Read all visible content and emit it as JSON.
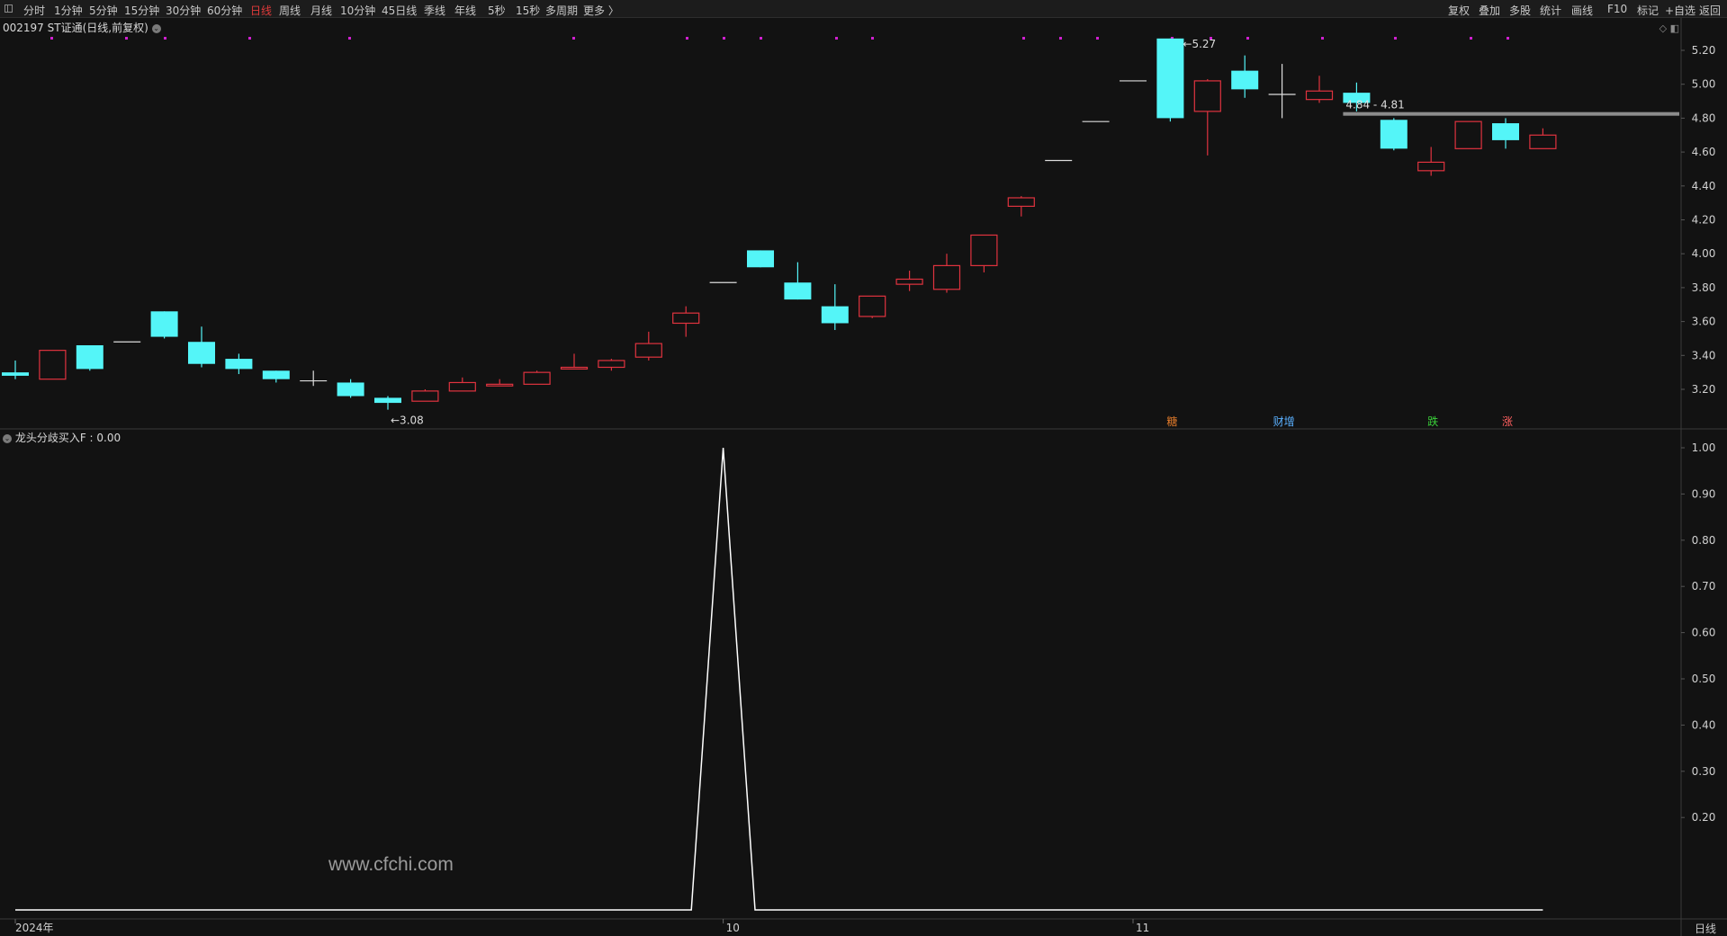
{
  "toolbar": {
    "periods": [
      {
        "label": "分时"
      },
      {
        "label": "1分钟"
      },
      {
        "label": "5分钟"
      },
      {
        "label": "15分钟"
      },
      {
        "label": "30分钟"
      },
      {
        "label": "60分钟"
      },
      {
        "label": "日线",
        "active": true
      },
      {
        "label": "周线"
      },
      {
        "label": "月线"
      },
      {
        "label": "10分钟"
      },
      {
        "label": "45日线"
      },
      {
        "label": "季线"
      },
      {
        "label": "年线"
      },
      {
        "label": "5秒"
      },
      {
        "label": "15秒"
      },
      {
        "label": "多周期"
      },
      {
        "label": "更多 〉"
      }
    ],
    "tools": [
      {
        "label": "复权"
      },
      {
        "label": "叠加"
      },
      {
        "label": "多股"
      },
      {
        "label": "统计"
      },
      {
        "label": "画线"
      },
      {
        "label": "F10"
      },
      {
        "label": "标记"
      },
      {
        "label": "+自选"
      },
      {
        "label": "返回"
      }
    ]
  },
  "main": {
    "title": "002197 ST证通(日线,前复权)",
    "price_ticks": [
      "5.20",
      "5.00",
      "4.80",
      "4.60",
      "4.40",
      "4.20",
      "4.00",
      "3.80",
      "3.60",
      "3.40",
      "3.20"
    ],
    "high_label": "5.27",
    "low_label": "3.08",
    "range_label": "4.84 - 4.81",
    "event_tags": [
      {
        "text": "糖",
        "color": "#e07a2a"
      },
      {
        "text": "财增",
        "color": "#5ab0ff"
      },
      {
        "text": "跌",
        "color": "#3ad03a"
      },
      {
        "text": "涨",
        "color": "#ff6060"
      }
    ],
    "colors": {
      "up": "#e0333f",
      "down": "#54f5f8",
      "flat": "#dcdcdc",
      "marker": "#d020d0",
      "resistance": "#8c8c8c"
    }
  },
  "indicator": {
    "title": "龙头分歧买入F : 0.00",
    "ticks": [
      "1.00",
      "0.90",
      "0.80",
      "0.70",
      "0.60",
      "0.50",
      "0.40",
      "0.30",
      "0.20"
    ],
    "line_color": "#ffffff"
  },
  "time_axis": {
    "labels": [
      "2024年",
      "10",
      "11"
    ]
  },
  "watermark": "www.cfchi.com",
  "bottom_right": "日线",
  "chart_data": {
    "type": "candlestick",
    "title": "002197 ST证通(日线,前复权)",
    "y_range": [
      3.08,
      5.27
    ],
    "candles": [
      {
        "o": 3.3,
        "h": 3.37,
        "l": 3.26,
        "c": 3.28
      },
      {
        "o": 3.26,
        "h": 3.43,
        "l": 3.26,
        "c": 3.43
      },
      {
        "o": 3.46,
        "h": 3.46,
        "l": 3.31,
        "c": 3.32
      },
      {
        "o": 3.48,
        "h": 3.48,
        "l": 3.48,
        "c": 3.48
      },
      {
        "o": 3.66,
        "h": 3.66,
        "l": 3.5,
        "c": 3.51
      },
      {
        "o": 3.48,
        "h": 3.57,
        "l": 3.33,
        "c": 3.35
      },
      {
        "o": 3.38,
        "h": 3.41,
        "l": 3.29,
        "c": 3.32
      },
      {
        "o": 3.31,
        "h": 3.31,
        "l": 3.24,
        "c": 3.26
      },
      {
        "o": 3.25,
        "h": 3.31,
        "l": 3.22,
        "c": 3.25
      },
      {
        "o": 3.24,
        "h": 3.26,
        "l": 3.15,
        "c": 3.16
      },
      {
        "o": 3.15,
        "h": 3.16,
        "l": 3.08,
        "c": 3.12
      },
      {
        "o": 3.13,
        "h": 3.2,
        "l": 3.13,
        "c": 3.19
      },
      {
        "o": 3.19,
        "h": 3.27,
        "l": 3.19,
        "c": 3.24
      },
      {
        "o": 3.22,
        "h": 3.26,
        "l": 3.22,
        "c": 3.23
      },
      {
        "o": 3.23,
        "h": 3.31,
        "l": 3.23,
        "c": 3.3
      },
      {
        "o": 3.32,
        "h": 3.41,
        "l": 3.32,
        "c": 3.33
      },
      {
        "o": 3.33,
        "h": 3.38,
        "l": 3.31,
        "c": 3.37
      },
      {
        "o": 3.39,
        "h": 3.54,
        "l": 3.37,
        "c": 3.47
      },
      {
        "o": 3.59,
        "h": 3.69,
        "l": 3.51,
        "c": 3.65
      },
      {
        "o": 3.83,
        "h": 3.83,
        "l": 3.83,
        "c": 3.83
      },
      {
        "o": 4.02,
        "h": 4.02,
        "l": 3.92,
        "c": 3.92
      },
      {
        "o": 3.83,
        "h": 3.95,
        "l": 3.73,
        "c": 3.73
      },
      {
        "o": 3.69,
        "h": 3.82,
        "l": 3.55,
        "c": 3.59
      },
      {
        "o": 3.63,
        "h": 3.75,
        "l": 3.62,
        "c": 3.75
      },
      {
        "o": 3.82,
        "h": 3.9,
        "l": 3.78,
        "c": 3.85
      },
      {
        "o": 3.79,
        "h": 4.0,
        "l": 3.77,
        "c": 3.93
      },
      {
        "o": 3.93,
        "h": 4.11,
        "l": 3.89,
        "c": 4.11
      },
      {
        "o": 4.28,
        "h": 4.34,
        "l": 4.22,
        "c": 4.33
      },
      {
        "o": 4.55,
        "h": 4.55,
        "l": 4.55,
        "c": 4.55
      },
      {
        "o": 4.78,
        "h": 4.78,
        "l": 4.78,
        "c": 4.78
      },
      {
        "o": 5.02,
        "h": 5.02,
        "l": 5.02,
        "c": 5.02
      },
      {
        "o": 5.27,
        "h": 5.27,
        "l": 4.78,
        "c": 4.8
      },
      {
        "o": 4.84,
        "h": 5.03,
        "l": 4.58,
        "c": 5.02
      },
      {
        "o": 5.08,
        "h": 5.17,
        "l": 4.92,
        "c": 4.97
      },
      {
        "o": 4.94,
        "h": 5.12,
        "l": 4.8,
        "c": 4.94
      },
      {
        "o": 4.91,
        "h": 5.05,
        "l": 4.89,
        "c": 4.96
      },
      {
        "o": 4.95,
        "h": 5.01,
        "l": 4.84,
        "c": 4.89
      },
      {
        "o": 4.79,
        "h": 4.8,
        "l": 4.61,
        "c": 4.62
      },
      {
        "o": 4.49,
        "h": 4.63,
        "l": 4.46,
        "c": 4.54
      },
      {
        "o": 4.62,
        "h": 4.78,
        "l": 4.62,
        "c": 4.78
      },
      {
        "o": 4.77,
        "h": 4.8,
        "l": 4.62,
        "c": 4.67
      },
      {
        "o": 4.62,
        "h": 4.74,
        "l": 4.62,
        "c": 4.7
      }
    ],
    "indicator_series": {
      "name": "龙头分歧买入F",
      "values": [
        0,
        0,
        0,
        0,
        0,
        0,
        0,
        0,
        0,
        0,
        0,
        0,
        0,
        0,
        0,
        0,
        0,
        0,
        0,
        1,
        0,
        0,
        0,
        0,
        0,
        0,
        0,
        0,
        0,
        0,
        0,
        0,
        0,
        0,
        0,
        0,
        0,
        0,
        0,
        0,
        0,
        0
      ]
    },
    "indicator_range": [
      0,
      1
    ]
  }
}
